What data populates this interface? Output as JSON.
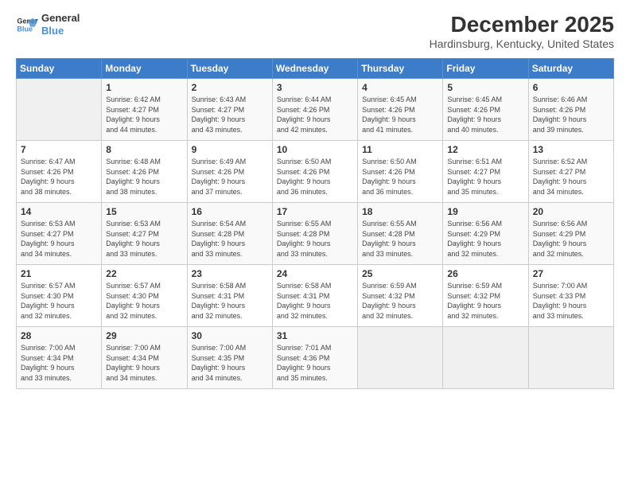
{
  "header": {
    "logo_line1": "General",
    "logo_line2": "Blue",
    "month": "December 2025",
    "location": "Hardinsburg, Kentucky, United States"
  },
  "weekdays": [
    "Sunday",
    "Monday",
    "Tuesday",
    "Wednesday",
    "Thursday",
    "Friday",
    "Saturday"
  ],
  "weeks": [
    [
      {
        "num": "",
        "info": ""
      },
      {
        "num": "1",
        "info": "Sunrise: 6:42 AM\nSunset: 4:27 PM\nDaylight: 9 hours\nand 44 minutes."
      },
      {
        "num": "2",
        "info": "Sunrise: 6:43 AM\nSunset: 4:27 PM\nDaylight: 9 hours\nand 43 minutes."
      },
      {
        "num": "3",
        "info": "Sunrise: 6:44 AM\nSunset: 4:26 PM\nDaylight: 9 hours\nand 42 minutes."
      },
      {
        "num": "4",
        "info": "Sunrise: 6:45 AM\nSunset: 4:26 PM\nDaylight: 9 hours\nand 41 minutes."
      },
      {
        "num": "5",
        "info": "Sunrise: 6:45 AM\nSunset: 4:26 PM\nDaylight: 9 hours\nand 40 minutes."
      },
      {
        "num": "6",
        "info": "Sunrise: 6:46 AM\nSunset: 4:26 PM\nDaylight: 9 hours\nand 39 minutes."
      }
    ],
    [
      {
        "num": "7",
        "info": "Sunrise: 6:47 AM\nSunset: 4:26 PM\nDaylight: 9 hours\nand 38 minutes."
      },
      {
        "num": "8",
        "info": "Sunrise: 6:48 AM\nSunset: 4:26 PM\nDaylight: 9 hours\nand 38 minutes."
      },
      {
        "num": "9",
        "info": "Sunrise: 6:49 AM\nSunset: 4:26 PM\nDaylight: 9 hours\nand 37 minutes."
      },
      {
        "num": "10",
        "info": "Sunrise: 6:50 AM\nSunset: 4:26 PM\nDaylight: 9 hours\nand 36 minutes."
      },
      {
        "num": "11",
        "info": "Sunrise: 6:50 AM\nSunset: 4:26 PM\nDaylight: 9 hours\nand 36 minutes."
      },
      {
        "num": "12",
        "info": "Sunrise: 6:51 AM\nSunset: 4:27 PM\nDaylight: 9 hours\nand 35 minutes."
      },
      {
        "num": "13",
        "info": "Sunrise: 6:52 AM\nSunset: 4:27 PM\nDaylight: 9 hours\nand 34 minutes."
      }
    ],
    [
      {
        "num": "14",
        "info": "Sunrise: 6:53 AM\nSunset: 4:27 PM\nDaylight: 9 hours\nand 34 minutes."
      },
      {
        "num": "15",
        "info": "Sunrise: 6:53 AM\nSunset: 4:27 PM\nDaylight: 9 hours\nand 33 minutes."
      },
      {
        "num": "16",
        "info": "Sunrise: 6:54 AM\nSunset: 4:28 PM\nDaylight: 9 hours\nand 33 minutes."
      },
      {
        "num": "17",
        "info": "Sunrise: 6:55 AM\nSunset: 4:28 PM\nDaylight: 9 hours\nand 33 minutes."
      },
      {
        "num": "18",
        "info": "Sunrise: 6:55 AM\nSunset: 4:28 PM\nDaylight: 9 hours\nand 33 minutes."
      },
      {
        "num": "19",
        "info": "Sunrise: 6:56 AM\nSunset: 4:29 PM\nDaylight: 9 hours\nand 32 minutes."
      },
      {
        "num": "20",
        "info": "Sunrise: 6:56 AM\nSunset: 4:29 PM\nDaylight: 9 hours\nand 32 minutes."
      }
    ],
    [
      {
        "num": "21",
        "info": "Sunrise: 6:57 AM\nSunset: 4:30 PM\nDaylight: 9 hours\nand 32 minutes."
      },
      {
        "num": "22",
        "info": "Sunrise: 6:57 AM\nSunset: 4:30 PM\nDaylight: 9 hours\nand 32 minutes."
      },
      {
        "num": "23",
        "info": "Sunrise: 6:58 AM\nSunset: 4:31 PM\nDaylight: 9 hours\nand 32 minutes."
      },
      {
        "num": "24",
        "info": "Sunrise: 6:58 AM\nSunset: 4:31 PM\nDaylight: 9 hours\nand 32 minutes."
      },
      {
        "num": "25",
        "info": "Sunrise: 6:59 AM\nSunset: 4:32 PM\nDaylight: 9 hours\nand 32 minutes."
      },
      {
        "num": "26",
        "info": "Sunrise: 6:59 AM\nSunset: 4:32 PM\nDaylight: 9 hours\nand 32 minutes."
      },
      {
        "num": "27",
        "info": "Sunrise: 7:00 AM\nSunset: 4:33 PM\nDaylight: 9 hours\nand 33 minutes."
      }
    ],
    [
      {
        "num": "28",
        "info": "Sunrise: 7:00 AM\nSunset: 4:34 PM\nDaylight: 9 hours\nand 33 minutes."
      },
      {
        "num": "29",
        "info": "Sunrise: 7:00 AM\nSunset: 4:34 PM\nDaylight: 9 hours\nand 34 minutes."
      },
      {
        "num": "30",
        "info": "Sunrise: 7:00 AM\nSunset: 4:35 PM\nDaylight: 9 hours\nand 34 minutes."
      },
      {
        "num": "31",
        "info": "Sunrise: 7:01 AM\nSunset: 4:36 PM\nDaylight: 9 hours\nand 35 minutes."
      },
      {
        "num": "",
        "info": ""
      },
      {
        "num": "",
        "info": ""
      },
      {
        "num": "",
        "info": ""
      }
    ]
  ]
}
